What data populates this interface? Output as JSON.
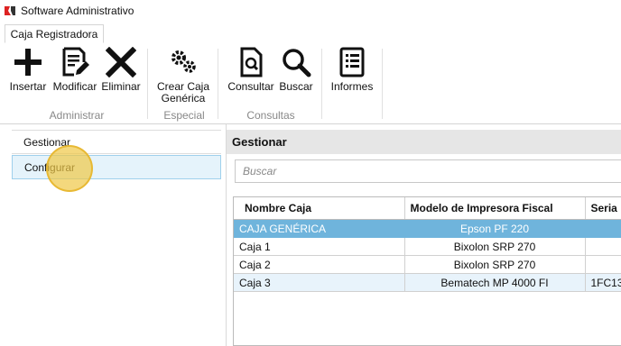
{
  "window": {
    "title": "Software Administrativo",
    "icon": "app-logo-icon"
  },
  "tabs": [
    {
      "label": "Caja Registradora",
      "active": true
    }
  ],
  "ribbon": {
    "buttons": {
      "insertar": {
        "label": "Insertar",
        "icon": "plus-icon"
      },
      "modificar": {
        "label": "Modificar",
        "icon": "edit-document-icon"
      },
      "eliminar": {
        "label": "Eliminar",
        "icon": "x-icon"
      },
      "crear_caja_1": {
        "label": "Crear Caja",
        "icon": "gears-icon"
      },
      "crear_caja_2": {
        "label": "Genérica"
      },
      "consultar": {
        "label": "Consultar",
        "icon": "search-document-icon"
      },
      "buscar": {
        "label": "Buscar",
        "icon": "magnifier-icon"
      },
      "informes": {
        "label": "Informes",
        "icon": "report-icon"
      }
    },
    "groups": {
      "administrar": "Administrar",
      "especial": "Especial",
      "consultas": "Consultas"
    }
  },
  "nav": {
    "items": [
      {
        "label": "Gestionar"
      },
      {
        "label": "Configurar",
        "active": true
      }
    ]
  },
  "panel": {
    "title": "Gestionar",
    "search_placeholder": "Buscar",
    "columns": [
      "Nombre Caja",
      "Modelo de Impresora Fiscal",
      "Seria"
    ],
    "rows": [
      {
        "nombre": "CAJA GENÉRICA",
        "modelo": "Epson PF 220",
        "serial": "",
        "selected": true
      },
      {
        "nombre": "Caja 1",
        "modelo": "Bixolon SRP 270",
        "serial": ""
      },
      {
        "nombre": "Caja 2",
        "modelo": "Bixolon SRP 270",
        "serial": ""
      },
      {
        "nombre": "Caja 3",
        "modelo": "Bematech MP 4000 FI",
        "serial": "1FC13"
      }
    ]
  },
  "colors": {
    "selection": "#6fb4dc",
    "alt_row": "#e8f3fb",
    "nav_active": "#e5f3fb",
    "cursor_highlight": "#f0c846"
  }
}
